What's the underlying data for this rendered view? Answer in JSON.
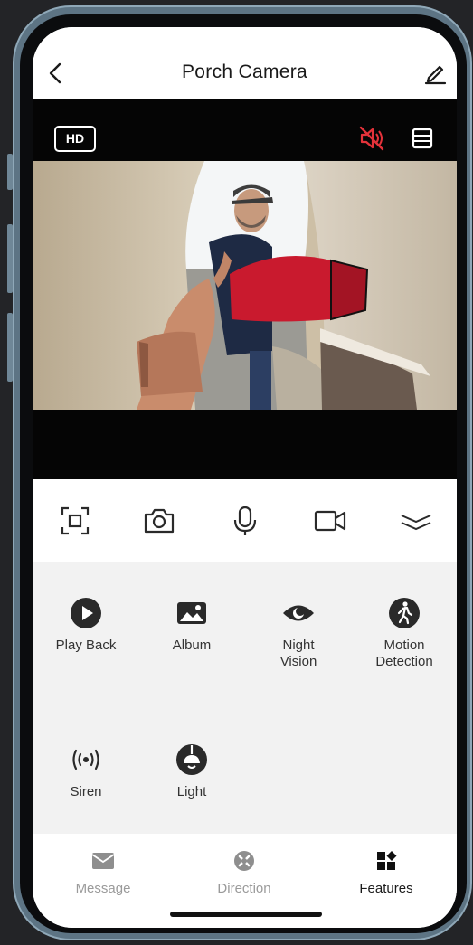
{
  "header": {
    "title": "Porch Camera"
  },
  "video": {
    "quality_label": "HD"
  },
  "features": [
    {
      "label_lines": [
        "Play Back"
      ],
      "icon": "play-circle-icon"
    },
    {
      "label_lines": [
        "Album"
      ],
      "icon": "image-icon"
    },
    {
      "label_lines": [
        "Night",
        "Vision"
      ],
      "icon": "eye-icon"
    },
    {
      "label_lines": [
        "Motion",
        "Detection"
      ],
      "icon": "walking-person-icon"
    },
    {
      "label_lines": [
        "Siren"
      ],
      "icon": "siren-icon"
    },
    {
      "label_lines": [
        "Light"
      ],
      "icon": "lamp-icon"
    }
  ],
  "tabs": [
    {
      "label": "Message",
      "icon": "envelope-icon",
      "active": false
    },
    {
      "label": "Direction",
      "icon": "direction-pad-icon",
      "active": false
    },
    {
      "label": "Features",
      "icon": "grid-icon",
      "active": true
    }
  ],
  "colors": {
    "mute_red": "#e4323a",
    "text_dark": "#1a1a1a",
    "tab_inactive": "#9a9a9a"
  }
}
